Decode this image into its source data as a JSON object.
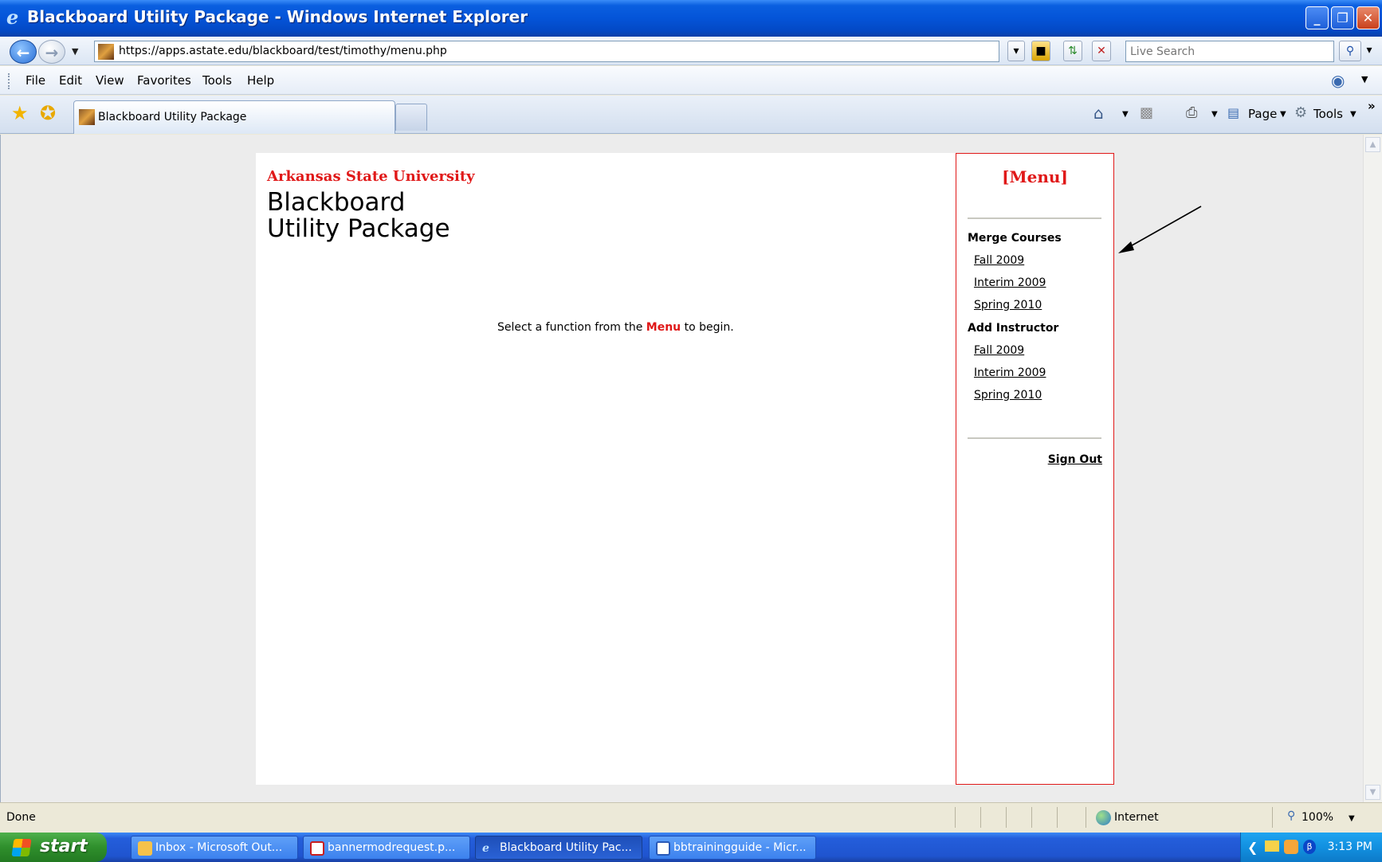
{
  "window": {
    "title": "Blackboard Utility Package - Windows Internet Explorer",
    "controls": {
      "minimize": "_",
      "restore": "❐",
      "close": "✕"
    }
  },
  "address_bar": {
    "url": "https://apps.astate.edu/blackboard/test/timothy/menu.php",
    "search_placeholder": "Live Search"
  },
  "menu_bar": {
    "items": [
      "File",
      "Edit",
      "View",
      "Favorites",
      "Tools",
      "Help"
    ]
  },
  "tabs": {
    "active_label": "Blackboard Utility Package"
  },
  "command_bar": {
    "page_label": "Page",
    "tools_label": "Tools",
    "more": "»"
  },
  "page": {
    "university": "Arkansas State University",
    "app_title_line1": "Blackboard",
    "app_title_line2": "Utility Package",
    "prompt_before": "Select a function from the ",
    "prompt_highlight": "Menu",
    "prompt_after": " to begin."
  },
  "side_menu": {
    "title": "[Menu]",
    "sections": [
      {
        "heading": "Merge Courses",
        "links": [
          "Fall 2009",
          "Interim 2009",
          "Spring 2010"
        ]
      },
      {
        "heading": "Add Instructor",
        "links": [
          "Fall 2009",
          "Interim 2009",
          "Spring 2010"
        ]
      }
    ],
    "sign_out": "Sign Out"
  },
  "status_bar": {
    "status": "Done",
    "zone": "Internet",
    "zoom": "100%"
  },
  "taskbar": {
    "start_label": "start",
    "tasks": [
      "Inbox - Microsoft Out...",
      "bannermodrequest.p...",
      "Blackboard Utility Pac...",
      "bbtrainingguide - Micr..."
    ],
    "clock": "3:13 PM"
  },
  "colors": {
    "accent_red": "#e01818",
    "titlebar_blue": "#0454d8",
    "taskbar_blue": "#245edb"
  }
}
